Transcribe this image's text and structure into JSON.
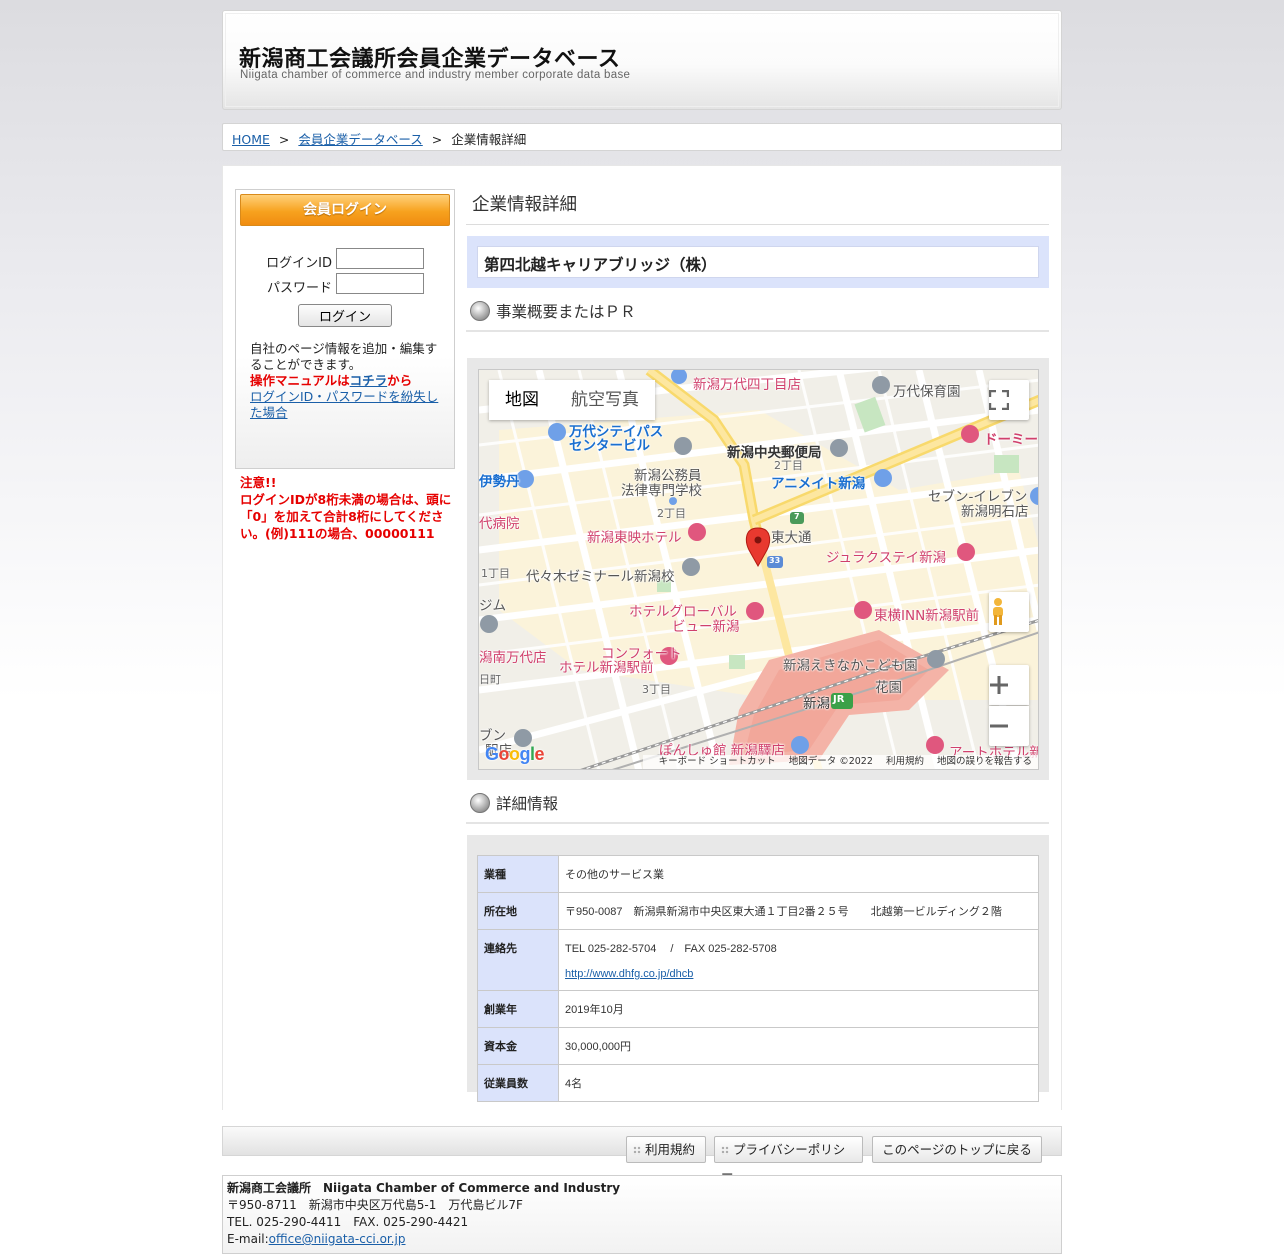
{
  "header": {
    "title": "新潟商工会議所会員企業データベース",
    "subtitle": "Niigata chamber of commerce and industry member corporate data base"
  },
  "breadcrumb": {
    "home": "HOME",
    "sep1": ">",
    "db": "会員企業データベース",
    "sep2": ">",
    "current": "企業情報詳細"
  },
  "sidebar": {
    "login_title": "会員ログイン",
    "login_id_label": "ログインID",
    "password_label": "パスワード",
    "login_id_value": "",
    "password_value": "",
    "login_button": "ログイン",
    "desc": "自社のページ情報を追加・編集することができます。",
    "manual_prefix": "操作マニュアルは",
    "manual_link": "コチラ",
    "manual_suffix": "から",
    "lost_link": "ログインID・パスワードを紛失した場合",
    "notice_title": "注意!!",
    "notice_body": "ログインIDが8桁未満の場合は、頭に「0」を加えて合計8桁にしてください。(例)111の場合、00000111"
  },
  "main": {
    "page_title": "企業情報詳細",
    "company_name": "第四北越キャリアブリッジ（株）",
    "section_pr": "事業概要またはＰＲ",
    "section_detail": "詳細情報"
  },
  "map": {
    "type_map": "地図",
    "type_satellite": "航空写真",
    "labels": {
      "l1": "新潟万代四丁目店",
      "l2": "万代保育園",
      "l3": "万代シテイパス",
      "l3b": "センタービル",
      "l4": "新潟中央郵便局",
      "l5": "ドーミー",
      "l6": "2丁目",
      "l7": "伊勢丹",
      "l8": "新潟公務員",
      "l8b": "法律専門学校",
      "l9": "アニメイト新潟",
      "l10": "セブン-イレブン",
      "l10b": "新潟明石店",
      "l11": "代病院",
      "l12": "2丁目",
      "l13": "新潟東映ホテル",
      "l14": "東大通",
      "l15": "ジュラクステイ新潟",
      "l16": "1丁目",
      "l17": "代々木ゼミナール新潟校",
      "l18": "ジム",
      "l19": "ホテルグローバル",
      "l19b": "ビュー新潟",
      "l20": "東横INN新潟駅前",
      "l21": "潟南万代店",
      "l22": "コンフォート",
      "l22b": "ホテル新潟駅前",
      "l23": "新潟えきなかこども園",
      "l24": "花園",
      "l25": "3丁目",
      "l26": "新潟",
      "l27": "ぽんしゅ館 新潟驛店",
      "l28": "アートホテル新",
      "l29": "ブン",
      "l29b": "駅店",
      "l30": "日町"
    },
    "attrib_keyboard": "キーボード ショートカット",
    "attrib_data": "地図データ ©2022",
    "attrib_terms": "利用規約",
    "attrib_report": "地図の誤りを報告する",
    "logo": "Google",
    "route_number": "33",
    "route_number2": "7",
    "jr": "JR"
  },
  "details": {
    "rows": [
      {
        "label": "業種",
        "value": "その他のサービス業"
      },
      {
        "label": "所在地",
        "value": "〒950-0087　新潟県新潟市中央区東大通１丁目2番２５号　　北越第一ビルディング２階"
      },
      {
        "label": "連絡先",
        "value": "TEL 025-282-5704　 /　FAX 025-282-5708",
        "link": "http://www.dhfg.co.jp/dhcb"
      },
      {
        "label": "創業年",
        "value": "2019年10月"
      },
      {
        "label": "資本金",
        "value": "30,000,000円"
      },
      {
        "label": "従業員数",
        "value": "4名"
      }
    ]
  },
  "footer": {
    "btn_terms": "利用規約",
    "btn_privacy": "プライバシーポリシー",
    "btn_top": "このページのトップに戻る",
    "org": "新潟商工会議所　Niigata Chamber of Commerce and Industry",
    "address": "〒950-8711　新潟市中央区万代島5-1　万代島ビル7F",
    "tel": "TEL. 025-290-4411　FAX. 025-290-4421",
    "email_label": "E-mail:",
    "email": "office@niigata-cci.or.jp"
  },
  "colors": {
    "accent_orange": "#f7a21e",
    "detail_header_bg": "#dbe3fb",
    "warning_red": "#e60000",
    "link_blue": "#1a5fa8"
  }
}
